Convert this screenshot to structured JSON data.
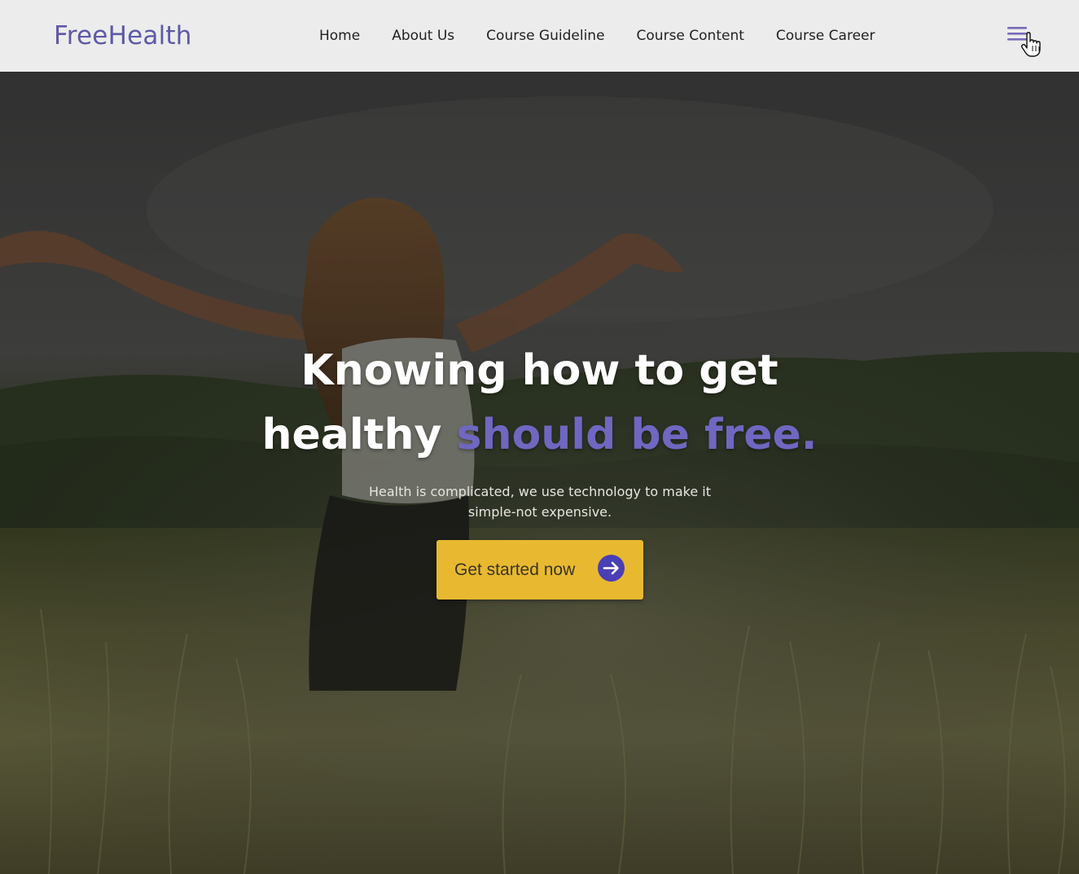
{
  "navbar": {
    "brand": "FreeHealth",
    "links": [
      {
        "label": "Home"
      },
      {
        "label": "About Us"
      },
      {
        "label": "Course Guideline"
      },
      {
        "label": "Course Content"
      },
      {
        "label": "Course Career"
      }
    ],
    "menu_icon": "hamburger-menu-icon",
    "cursor_icon": "hand-pointer-cursor-icon"
  },
  "hero": {
    "headline_line1": "Knowing how to get",
    "headline_line2_plain": "healthy",
    "headline_line2_accent": "should be free.",
    "subtitle": "Health is complicated, we use technology to make it simple-not expensive.",
    "cta_label": "Get started now",
    "cta_icon": "arrow-right-circle-icon",
    "background_image": "woman-arms-outstretched-in-grass-field-photo"
  },
  "colors": {
    "brand": "#5c5aa6",
    "accent": "#6f67c0",
    "navbar_bg": "#ececec",
    "cta_bg": "#e8b930",
    "cta_icon_bg": "#4a3fb4"
  }
}
